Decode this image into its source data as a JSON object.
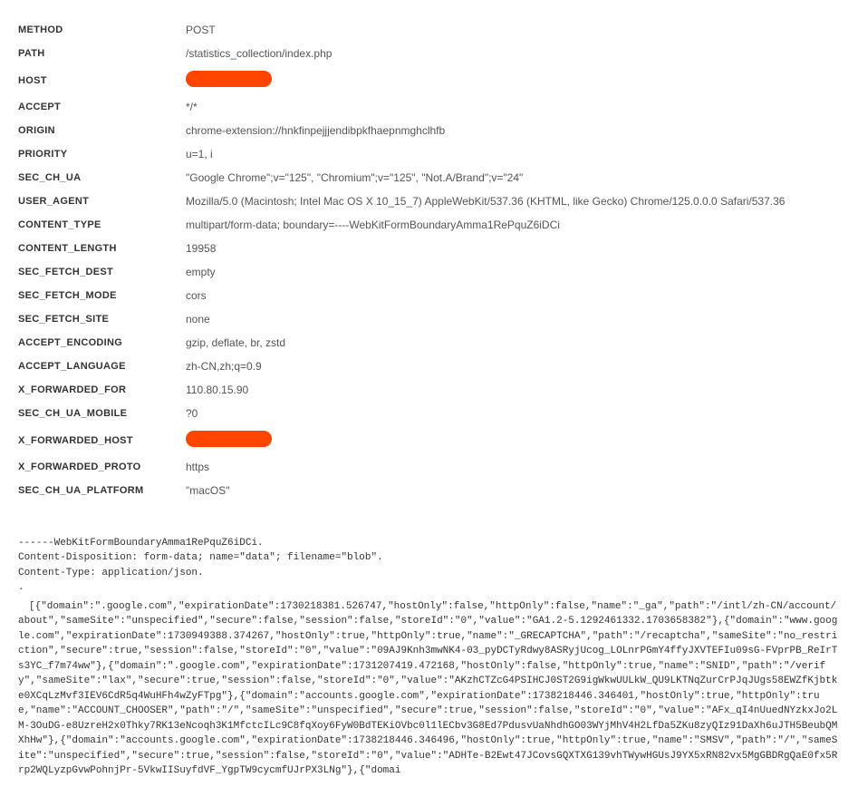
{
  "headers": [
    {
      "key": "METHOD",
      "value": "POST",
      "redacted": false
    },
    {
      "key": "PATH",
      "value": "/statistics_collection/index.php",
      "redacted": false
    },
    {
      "key": "HOST",
      "value": "",
      "redacted": true
    },
    {
      "key": "ACCEPT",
      "value": "*/*",
      "redacted": false
    },
    {
      "key": "ORIGIN",
      "value": "chrome-extension://hnkfinpejjjendibpkfhaepnmghclhfb",
      "redacted": false
    },
    {
      "key": "PRIORITY",
      "value": "u=1, i",
      "redacted": false
    },
    {
      "key": "SEC_CH_UA",
      "value": "\"Google Chrome\";v=\"125\", \"Chromium\";v=\"125\", \"Not.A/Brand\";v=\"24\"",
      "redacted": false
    },
    {
      "key": "USER_AGENT",
      "value": "Mozilla/5.0 (Macintosh; Intel Mac OS X 10_15_7) AppleWebKit/537.36 (KHTML, like Gecko) Chrome/125.0.0.0 Safari/537.36",
      "redacted": false
    },
    {
      "key": "CONTENT_TYPE",
      "value": "multipart/form-data; boundary=----WebKitFormBoundaryAmma1RePquZ6iDCi",
      "redacted": false
    },
    {
      "key": "CONTENT_LENGTH",
      "value": "19958",
      "redacted": false
    },
    {
      "key": "SEC_FETCH_DEST",
      "value": "empty",
      "redacted": false
    },
    {
      "key": "SEC_FETCH_MODE",
      "value": "cors",
      "redacted": false
    },
    {
      "key": "SEC_FETCH_SITE",
      "value": "none",
      "redacted": false
    },
    {
      "key": "ACCEPT_ENCODING",
      "value": "gzip, deflate, br, zstd",
      "redacted": false
    },
    {
      "key": "ACCEPT_LANGUAGE",
      "value": "zh-CN,zh;q=0.9",
      "redacted": false
    },
    {
      "key": "X_FORWARDED_FOR",
      "value": "110.80.15.90",
      "redacted": false
    },
    {
      "key": "SEC_CH_UA_MOBILE",
      "value": "?0",
      "redacted": false
    },
    {
      "key": "X_FORWARDED_HOST",
      "value": "",
      "redacted": true
    },
    {
      "key": "X_FORWARDED_PROTO",
      "value": "https",
      "redacted": false
    },
    {
      "key": "SEC_CH_UA_PLATFORM",
      "value": "\"macOS\"",
      "redacted": false
    }
  ],
  "body": {
    "lines": [
      "------WebKitFormBoundaryAmma1RePquZ6iDCi.",
      "Content-Disposition: form-data; name=\"data\"; filename=\"blob\".",
      "Content-Type: application/json.",
      "."
    ],
    "json": "[{\"domain\":\".google.com\",\"expirationDate\":1730218381.526747,\"hostOnly\":false,\"httpOnly\":false,\"name\":\"_ga\",\"path\":\"/intl/zh-CN/account/about\",\"sameSite\":\"unspecified\",\"secure\":false,\"session\":false,\"storeId\":\"0\",\"value\":\"GA1.2-5.1292461332.1703658382\"},{\"domain\":\"www.google.com\",\"expirationDate\":1730949388.374267,\"hostOnly\":true,\"httpOnly\":true,\"name\":\"_GRECAPTCHA\",\"path\":\"/recaptcha\",\"sameSite\":\"no_restriction\",\"secure\":true,\"session\":false,\"storeId\":\"0\",\"value\":\"09AJ9Knh3mwNK4-03_pyDCTyRdwy8ASRyjUcog_LOLnrPGmY4ffyJXVTEFIu09sG-FVprPB_ReIrTs3YC_f7m74ww\"},{\"domain\":\".google.com\",\"expirationDate\":1731207419.472168,\"hostOnly\":false,\"httpOnly\":true,\"name\":\"SNID\",\"path\":\"/verify\",\"sameSite\":\"lax\",\"secure\":true,\"session\":false,\"storeId\":\"0\",\"value\":\"AKzhCTZcG4PSIHCJ0ST2G9igWkwUULkW_QU9LKTNqZurCrPJqJUgs58EWZfKjbtke0XCqLzMvf3IEV6CdR5q4WuHFh4wZyFTpg\"},{\"domain\":\"accounts.google.com\",\"expirationDate\":1738218446.346401,\"hostOnly\":true,\"httpOnly\":true,\"name\":\"ACCOUNT_CHOOSER\",\"path\":\"/\",\"sameSite\":\"unspecified\",\"secure\":true,\"session\":false,\"storeId\":\"0\",\"value\":\"AFx_qI4nUuedNYzkxJo2LM-3OuDG-e8UzreH2x0Thky7RK13eNcoqh3K1MfctcILc9C8fqXoy6FyW0BdTEKiOVbc0l1lECbv3G8Ed7PdusvUaNhdhGO03WYjMhV4H2LfDa5ZKu8zyQIz91DaXh6uJTH5BeubQMXhHw\"},{\"domain\":\"accounts.google.com\",\"expirationDate\":1738218446.346496,\"hostOnly\":true,\"httpOnly\":true,\"name\":\"SMSV\",\"path\":\"/\",\"sameSite\":\"unspecified\",\"secure\":true,\"session\":false,\"storeId\":\"0\",\"value\":\"ADHTe-B2Ewt47JCovsGQXTXG139vhTWywHGUsJ9YX5xRN82vx5MgGBDRgQaE0fx5Rrp2WQLyzpGvwPohnjPr-5VkwIISuyfdVF_YgpTW9cycmfUJrPX3LNg\"},{\"domai"
  }
}
